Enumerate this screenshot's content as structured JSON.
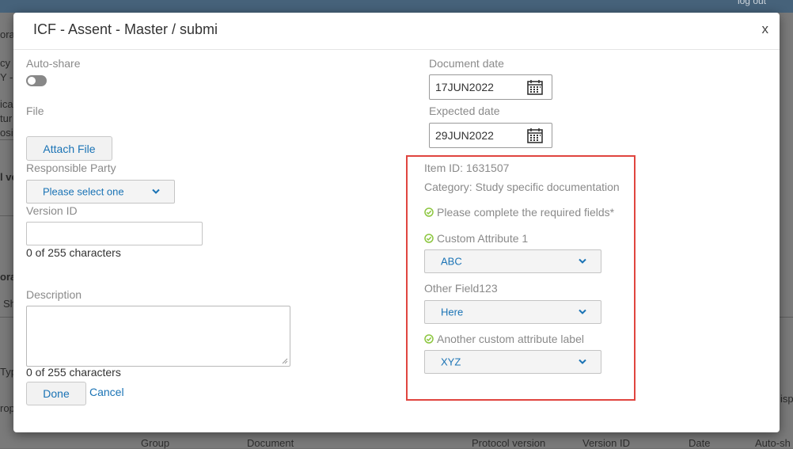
{
  "background": {
    "logout": "log out",
    "fragments": [
      "ora",
      "cy a",
      "Y -",
      "ica",
      "tur",
      "osi",
      "l ve",
      "ora",
      "Sh",
      "Typ",
      "rop",
      "isp"
    ],
    "columns": [
      "Group",
      "Document",
      "Protocol version",
      "Version ID",
      "Date",
      "Auto-sh"
    ]
  },
  "modal": {
    "title": "ICF - Assent - Master / submi",
    "close": "x",
    "left": {
      "autoshare_label": "Auto-share",
      "file_label": "File",
      "attach_button": "Attach File",
      "responsible_party_label": "Responsible Party",
      "responsible_party_value": "Please select one",
      "version_id_label": "Version ID",
      "version_id_value": "",
      "version_id_counter": "0 of 255 characters",
      "description_label": "Description",
      "description_value": "",
      "description_counter": "0 of 255 characters",
      "done_button": "Done",
      "cancel_link": "Cancel"
    },
    "right": {
      "document_date_label": "Document date",
      "document_date_value": "17JUN2022",
      "expected_date_label": "Expected date",
      "expected_date_value": "29JUN2022",
      "item_id": "Item ID: 1631507",
      "category": "Category: Study specific documentation",
      "required_note": "Please complete the required fields*",
      "custom_attr_1_label": "Custom Attribute 1",
      "custom_attr_1_value": "ABC",
      "other_field_label": "Other Field123",
      "other_field_value": "Here",
      "another_attr_label": "Another custom attribute label",
      "another_attr_value": "XYZ"
    }
  },
  "colors": {
    "accent": "#1a73b5",
    "check": "#8cc63f",
    "highlight": "#e0453f"
  }
}
